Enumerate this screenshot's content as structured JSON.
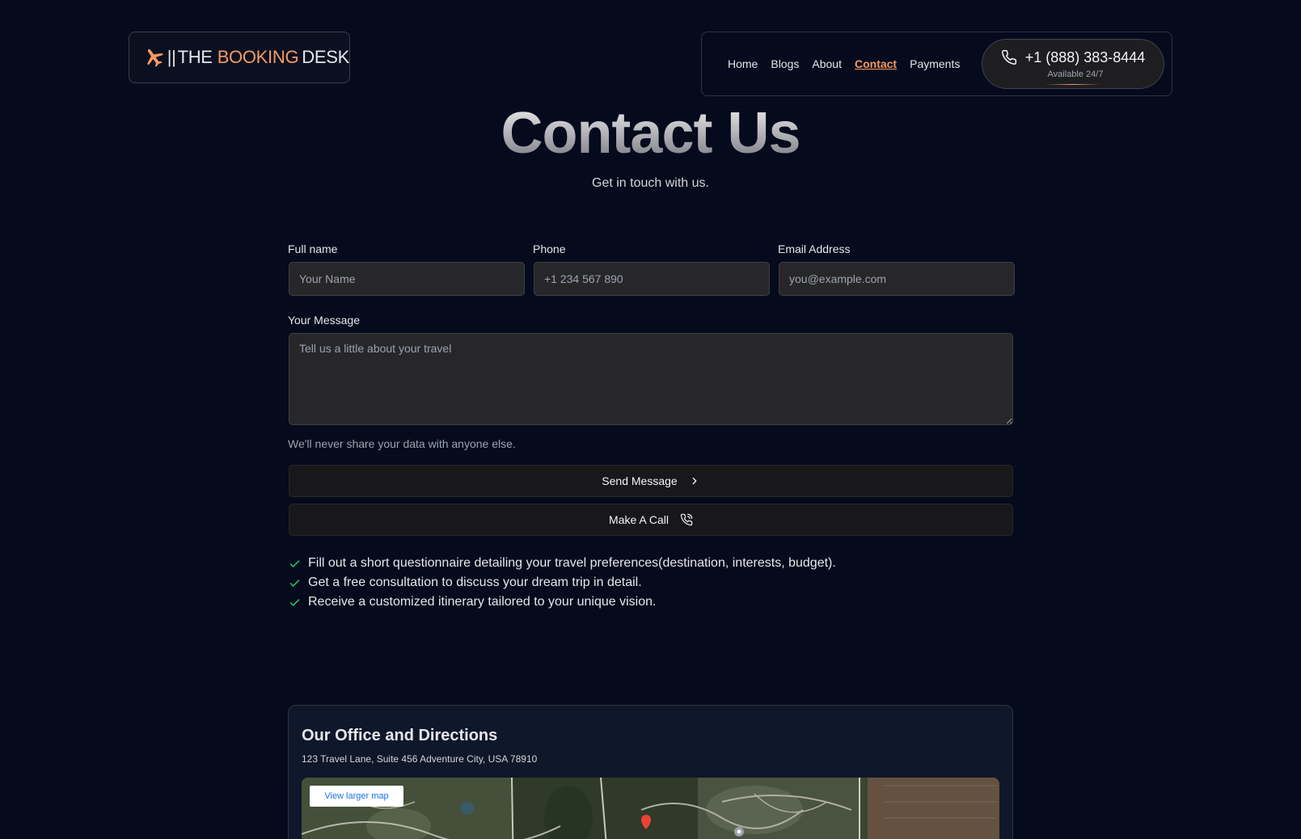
{
  "brand": {
    "bars": "||",
    "the": "THE",
    "booking": "BOOKING",
    "desk": "DESK"
  },
  "nav": {
    "items": [
      {
        "label": "Home",
        "active": false
      },
      {
        "label": "Blogs",
        "active": false
      },
      {
        "label": "About",
        "active": false
      },
      {
        "label": "Contact",
        "active": true
      },
      {
        "label": "Payments",
        "active": false
      }
    ],
    "phone": "+1 (888) 383-8444",
    "phone_sub": "Available 24/7"
  },
  "hero": {
    "title": "Contact Us",
    "subtitle": "Get in touch with us."
  },
  "form": {
    "full_name": {
      "label": "Full name",
      "placeholder": "Your Name",
      "value": ""
    },
    "phone": {
      "label": "Phone",
      "placeholder": "+1 234 567 890",
      "value": ""
    },
    "email": {
      "label": "Email Address",
      "placeholder": "you@example.com",
      "value": ""
    },
    "message": {
      "label": "Your Message",
      "placeholder": "Tell us a little about your travel",
      "value": ""
    },
    "help": "We'll never share your data with anyone else.",
    "send_label": "Send Message",
    "call_label": "Make A Call"
  },
  "checklist": [
    "Fill out a short questionnaire detailing your travel preferences(destination, interests, budget).",
    "Get a free consultation to discuss your dream trip in detail.",
    "Receive a customized itinerary tailored to your unique vision."
  ],
  "office": {
    "title": "Our Office and Directions",
    "address": "123 Travel Lane, Suite 456 Adventure City, USA 78910",
    "map_link": "View larger map"
  },
  "colors": {
    "accent": "#f59a62",
    "background": "#050a1c",
    "check": "#22c55e"
  }
}
